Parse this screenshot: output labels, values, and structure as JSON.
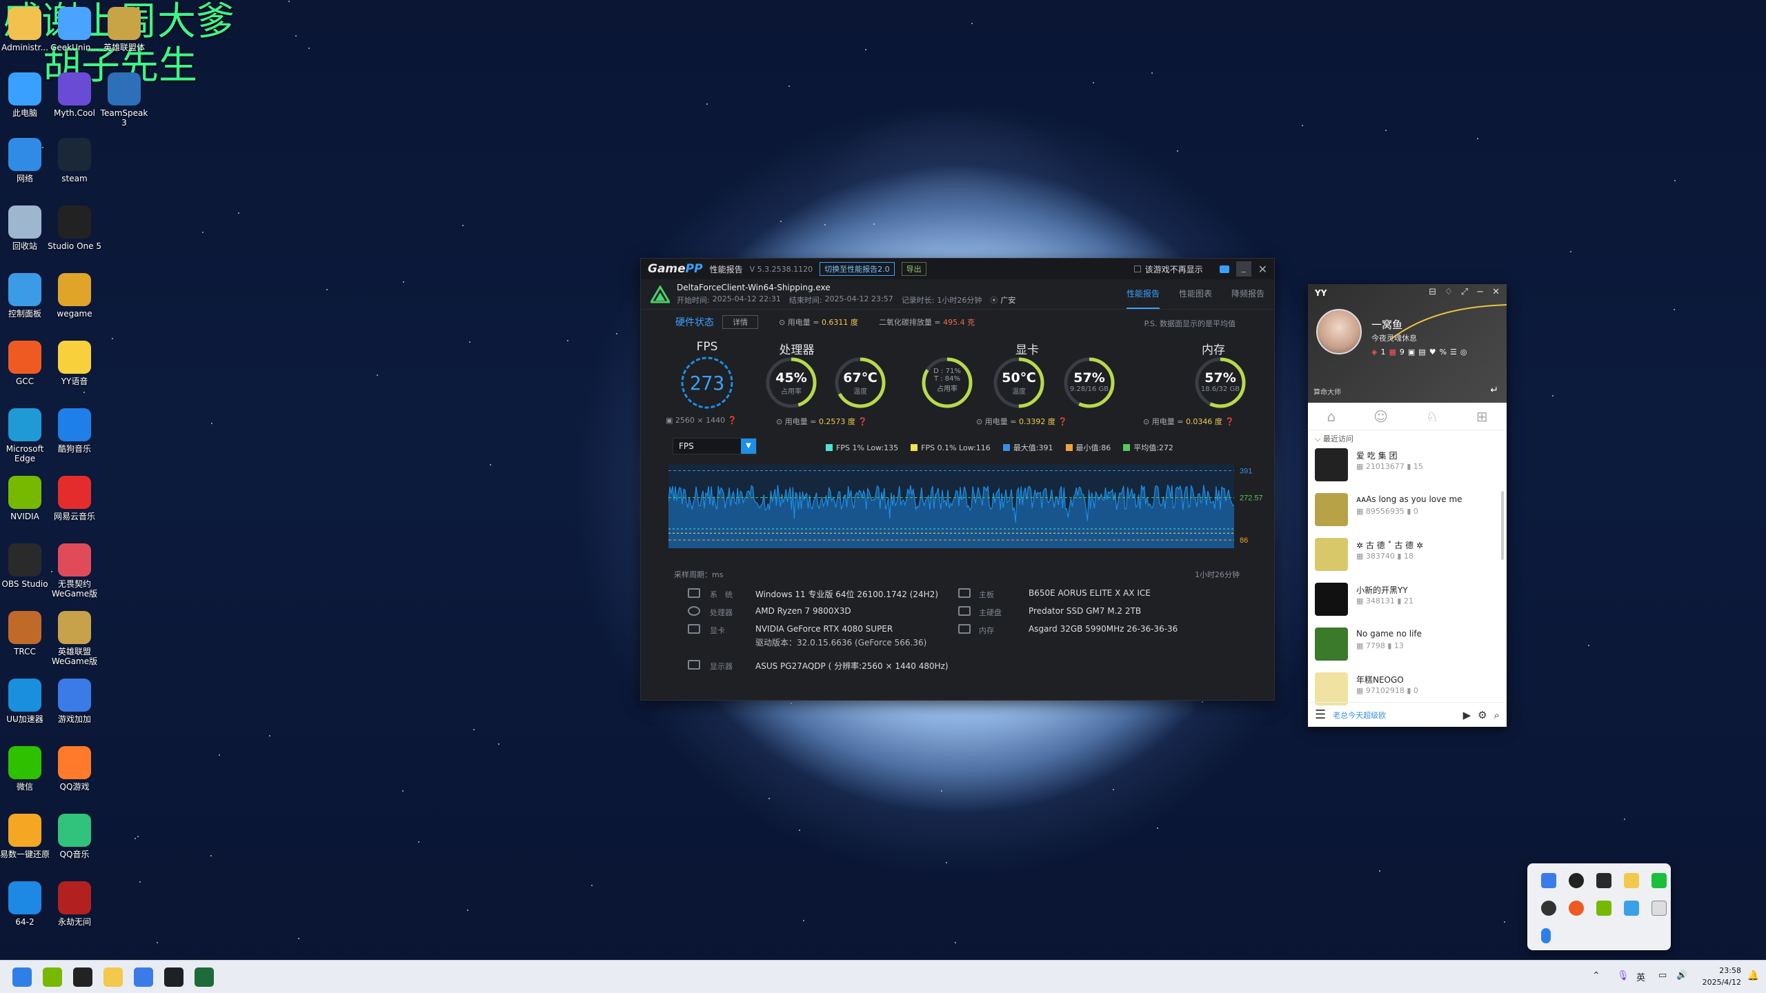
{
  "overlay": {
    "line1": "感谢上周大爹",
    "line2": "胡子先生"
  },
  "desktop_icons": [
    {
      "label": "Administr...",
      "icon": "folder-icon",
      "color": "#f2c14e"
    },
    {
      "label": "GeekUnin...",
      "icon": "app-icon",
      "color": "#4aa3ff"
    },
    {
      "label": "英雄联盟体",
      "icon": "game-icon",
      "color": "#c9a447"
    },
    {
      "label": "此电脑",
      "icon": "computer-icon",
      "color": "#3aa0ff"
    },
    {
      "label": "Myth.Cool",
      "icon": "myth-icon",
      "color": "#6a4bd6"
    },
    {
      "label": "TeamSpeak 3",
      "icon": "teamspeak-icon",
      "color": "#2d6fb8"
    },
    {
      "label": "网络",
      "icon": "network-icon",
      "color": "#2f8be6"
    },
    {
      "label": "steam",
      "icon": "steam-icon",
      "color": "#1b2838"
    },
    {
      "label": "回收站",
      "icon": "recycle-bin-icon",
      "color": "#9fb6cf"
    },
    {
      "label": "Studio One 5",
      "icon": "studio-one-icon",
      "color": "#222"
    },
    {
      "label": "控制面板",
      "icon": "control-panel-icon",
      "color": "#3c9be6"
    },
    {
      "label": "wegame",
      "icon": "wegame-icon",
      "color": "#e0a428"
    },
    {
      "label": "GCC",
      "icon": "gcc-icon",
      "color": "#ef5a23"
    },
    {
      "label": "YY语音",
      "icon": "yy-icon",
      "color": "#f7d03c"
    },
    {
      "label": "Microsoft Edge",
      "icon": "edge-icon",
      "color": "#1f9ad6"
    },
    {
      "label": "酷狗音乐",
      "icon": "kugou-icon",
      "color": "#1f7fe8"
    },
    {
      "label": "NVIDIA",
      "icon": "nvidia-icon",
      "color": "#76b900"
    },
    {
      "label": "网易云音乐",
      "icon": "netease-music-icon",
      "color": "#e52c2c"
    },
    {
      "label": "OBS Studio",
      "icon": "obs-icon",
      "color": "#2a2a2a"
    },
    {
      "label": "无畏契约 WeGame版",
      "icon": "valorant-icon",
      "color": "#e04b5a"
    },
    {
      "label": "TRCC",
      "icon": "trcc-icon",
      "color": "#c06a2a"
    },
    {
      "label": "英雄联盟 WeGame版",
      "icon": "lol-icon",
      "color": "#c8a24a"
    },
    {
      "label": "UU加速器",
      "icon": "uu-icon",
      "color": "#1a8fdd"
    },
    {
      "label": "游戏加加",
      "icon": "game-plus-icon",
      "color": "#3a7be8"
    },
    {
      "label": "微信",
      "icon": "wechat-icon",
      "color": "#2dc100"
    },
    {
      "label": "QQ游戏",
      "icon": "qq-game-icon",
      "color": "#ff7a2a"
    },
    {
      "label": "易数一键还原",
      "icon": "restore-icon",
      "color": "#f5a623"
    },
    {
      "label": "QQ音乐",
      "icon": "qq-music-icon",
      "color": "#31c27c"
    },
    {
      "label": "64-2",
      "icon": "shortcut-icon",
      "color": "#1e88e5"
    },
    {
      "label": "永劫无间",
      "icon": "naraka-icon",
      "color": "#b32020"
    }
  ],
  "gamepp": {
    "logo_a": "Game",
    "logo_b": "PP",
    "title": "性能报告",
    "version": "V 5.3.2538.1120",
    "switch_btn": "切换至性能报告2.0",
    "export_btn": "导出",
    "no_show": "该游戏不再显示",
    "process": "DeltaForceClient-Win64-Shipping.exe",
    "start_label": "开始时间:",
    "start": "2025-04-12 22:31",
    "end_label": "结束时间:",
    "end": "2025-04-12 23:57",
    "duration_label": "记录时长:",
    "duration": "1小时26分钟",
    "location": "广安",
    "tabs": [
      "性能报告",
      "性能图表",
      "降频报告"
    ],
    "hw_status": "硬件状态",
    "detail_btn": "详情",
    "power_label": "用电量 = ",
    "power_total": "0.6311 度",
    "co2_label": "二氧化碳排放量 = ",
    "co2": "495.4 克",
    "ps_note": "P.S. 数据面显示的是平均值",
    "fps_title": "FPS",
    "fps_value": "273",
    "resolution": "2560 × 1440",
    "cpu_title": "处理器",
    "cpu_usage": "45%",
    "cpu_usage_lbl": "占用率",
    "cpu_usage_frac": 0.45,
    "cpu_temp": "67℃",
    "cpu_temp_lbl": "温度",
    "cpu_temp_frac": 0.67,
    "cpu_power": "0.2573 度",
    "gpu_title": "显卡",
    "gpu_d": "D : 71%",
    "gpu_t": "T : 84%",
    "gpu_usage_lbl": "占用率",
    "gpu_usage_frac": 0.84,
    "gpu_temp": "50℃",
    "gpu_temp_lbl": "温度",
    "gpu_temp_frac": 0.5,
    "gpu_mem": "57%",
    "gpu_mem_sub": "9.28/16 GB",
    "gpu_mem_frac": 0.57,
    "gpu_power": "0.3392 度",
    "ram_title": "内存",
    "ram": "57%",
    "ram_sub": "18.6/32 GB",
    "ram_frac": 0.57,
    "ram_power": "0.0346 度",
    "metric_select": "FPS",
    "legend": [
      {
        "text": "FPS 1% Low:135",
        "color": "#4be3d8"
      },
      {
        "text": "FPS 0.1% Low:116",
        "color": "#f5e14a"
      },
      {
        "text": "最大值:391",
        "color": "#3a8fe0"
      },
      {
        "text": "最小值:86",
        "color": "#f2a23a"
      },
      {
        "text": "平均值:272",
        "color": "#58c95a"
      }
    ],
    "sample_label": "采样周期：ms",
    "duration_short": "1小时26分钟",
    "info": {
      "sys_lbl": "系　统",
      "sys": "Windows 11 专业版 64位 26100.1742 (24H2)",
      "cpu_lbl": "处理器",
      "cpu": "AMD Ryzen 7 9800X3D",
      "gpu_lbl": "显卡",
      "gpu": "NVIDIA GeForce RTX 4080 SUPER",
      "driver": "驱动版本：32.0.15.6636 (GeForce 566.36)",
      "mon_lbl": "显示器",
      "mon": "ASUS PG27AQDP ( 分辨率:2560 × 1440 480Hz)",
      "mb_lbl": "主板",
      "mb": "B650E AORUS ELITE X AX ICE",
      "disk_lbl": "主硬盘",
      "disk": "Predator SSD GM7 M.2 2TB",
      "mem_lbl": "内存",
      "mem": "Asgard 32GB 5990MHz 26-36-36-36"
    }
  },
  "chart_data": {
    "type": "line",
    "title": "",
    "series": [
      {
        "name": "FPS",
        "color": "#1d8fe6"
      }
    ],
    "ylabels": [
      "391",
      "272.57",
      "86"
    ],
    "y_max": 391,
    "y_avg": 272.57,
    "y_min": 86,
    "ylim": [
      50,
      420
    ]
  },
  "yy": {
    "app": "YY",
    "username": "一窝鱼",
    "status": "今夜灵魂休息",
    "badge_count": "1",
    "badge2": "9",
    "section": "最近访问",
    "bottom_hint": "老总今天超级欧",
    "side_text": "算命大师",
    "items": [
      {
        "name": "爱 吃 集 团",
        "id": "21013677",
        "count": "15",
        "color": "#222"
      },
      {
        "name": "ᴀᴀAs long as you love me",
        "id": "89556935",
        "count": "0",
        "color": "#b8a248"
      },
      {
        "name": "✲ 古 德 ˚ 古 德 ✲",
        "id": "383740",
        "count": "18",
        "color": "#d9c86a"
      },
      {
        "name": "小新的开黑YY",
        "id": "348131",
        "count": "21",
        "color": "#111"
      },
      {
        "name": "No game no life",
        "id": "7798",
        "count": "13",
        "color": "#3a7a2a"
      },
      {
        "name": "年糕NEOGO",
        "id": "97102918",
        "count": "0",
        "color": "#f0e2a0"
      }
    ]
  },
  "taskbar": {
    "time": "23:58",
    "date": "2025/4/12",
    "ime": "英",
    "icons": [
      "windows-start-icon",
      "nvidia-app-icon",
      "obs-taskbar-icon",
      "yy-taskbar-icon",
      "gamepp-taskbar-icon",
      "terminal-taskbar-icon",
      "deltaforce-taskbar-icon"
    ]
  }
}
